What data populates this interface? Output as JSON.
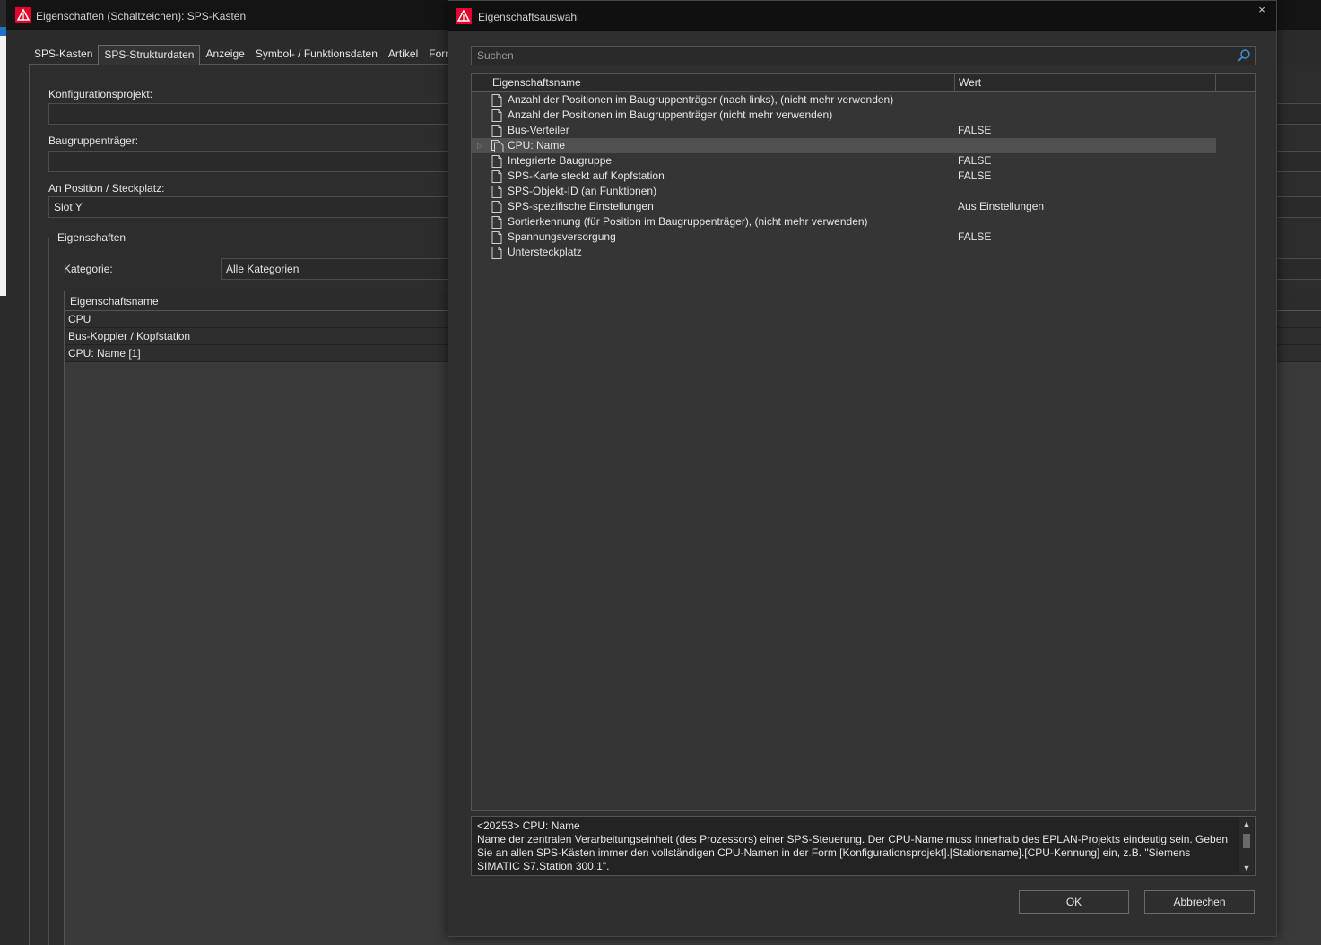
{
  "background_window": {
    "title": "Eigenschaften (Schaltzeichen): SPS-Kasten",
    "tabs": [
      "SPS-Kasten",
      "SPS-Strukturdaten",
      "Anzeige",
      "Symbol- / Funktionsdaten",
      "Artikel",
      "Form"
    ],
    "active_tab": "SPS-Strukturdaten",
    "fields": {
      "konfigurationsprojekt_label": "Konfigurationsprojekt:",
      "konfigurationsprojekt_value": "",
      "baugruppentraeger_label": "Baugruppenträger:",
      "baugruppentraeger_value": "",
      "position_label": "An Position / Steckplatz:",
      "position_value": "Slot Y"
    },
    "properties_group": {
      "legend": "Eigenschaften",
      "kategorie_label": "Kategorie:",
      "kategorie_value": "Alle Kategorien",
      "table_header": "Eigenschaftsname",
      "rows": [
        "CPU",
        "Bus-Koppler / Kopfstation",
        "CPU: Name [1]"
      ]
    }
  },
  "dialog": {
    "title": "Eigenschaftsauswahl",
    "close_glyph": "×",
    "search_placeholder": "Suchen",
    "columns": {
      "name": "Eigenschaftsname",
      "value": "Wert"
    },
    "rows": [
      {
        "name": "Anzahl der Positionen im Baugruppenträger (nach links), (nicht mehr verwenden)",
        "value": "",
        "icon": "document-icon"
      },
      {
        "name": "Anzahl der Positionen im Baugruppenträger (nicht mehr verwenden)",
        "value": "",
        "icon": "document-icon"
      },
      {
        "name": "Bus-Verteiler",
        "value": "FALSE",
        "icon": "document-icon"
      },
      {
        "name": "CPU: Name",
        "value": "",
        "icon": "multi-document-icon",
        "expandable": true,
        "selected": true
      },
      {
        "name": "Integrierte Baugruppe",
        "value": "FALSE",
        "icon": "document-icon"
      },
      {
        "name": "SPS-Karte steckt auf Kopfstation",
        "value": "FALSE",
        "icon": "document-icon"
      },
      {
        "name": "SPS-Objekt-ID (an Funktionen)",
        "value": "",
        "icon": "document-icon"
      },
      {
        "name": "SPS-spezifische Einstellungen",
        "value": "Aus Einstellungen",
        "icon": "document-icon"
      },
      {
        "name": "Sortierkennung (für Position im Baugruppenträger), (nicht mehr verwenden)",
        "value": "",
        "icon": "document-icon"
      },
      {
        "name": "Spannungsversorgung",
        "value": "FALSE",
        "icon": "document-icon"
      },
      {
        "name": "Untersteckplatz",
        "value": "",
        "icon": "document-icon"
      }
    ],
    "description": {
      "heading": "<20253> CPU: Name",
      "text": "Name der zentralen Verarbeitungseinheit (des Prozessors) einer SPS-Steuerung. Der CPU-Name muss innerhalb des EPLAN-Projekts eindeutig sein. Geben Sie an allen SPS-Kästen immer den vollständigen CPU-Namen in der Form [Konfigurationsprojekt].[Stationsname].[CPU-Kennung] ein, z.B. \"Siemens SIMATIC S7.Station 300.1\"."
    },
    "buttons": {
      "ok": "OK",
      "cancel": "Abbrechen"
    }
  },
  "colors": {
    "accent": "#e4002b",
    "background": "#2f2f2f",
    "titlebar": "#101010",
    "selection": "#505050"
  }
}
